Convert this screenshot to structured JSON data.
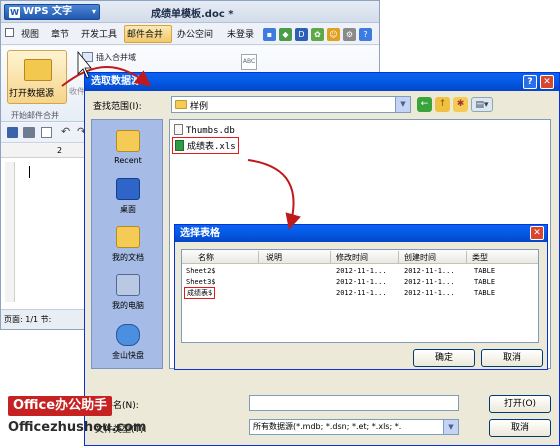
{
  "wps": {
    "app_button": "WPS 文字",
    "doc_title": "成绩单模板.doc *",
    "menu": [
      "视图",
      "章节",
      "开发工具",
      "邮件合并",
      "办公空间",
      "未登录"
    ],
    "ribbon": {
      "open_datasource": "打开数据源",
      "collect": "收件",
      "insert_merge_field": "插入合并域",
      "group_label": "开始邮件合并"
    },
    "ruler_mark": "2",
    "status_bar": "页面: 1/1   节:"
  },
  "dialog_select_source": {
    "title": "选取数据源",
    "lookin_label": "查找范围(I):",
    "lookin_value": "样例",
    "places": [
      "Recent",
      "桌面",
      "我的文档",
      "我的电脑",
      "金山快盘"
    ],
    "files": [
      "Thumbs.db",
      "成绩表.xls"
    ],
    "filename_label": "文件名(N):",
    "filename_value": "",
    "filetype_label": "文件类型(T):",
    "filetype_value": "所有数据源(*.mdb; *.dsn; *.et; *.xls; *.",
    "open_button": "打开(O)",
    "cancel_button": "取消"
  },
  "dialog_select_table": {
    "title": "选择表格",
    "columns": [
      "名称",
      "说明",
      "修改时间",
      "创建时间",
      "类型"
    ],
    "rows": [
      {
        "name": "Sheet2$",
        "desc": "",
        "modified": "2012-11-1...",
        "created": "2012-11-1...",
        "type": "TABLE"
      },
      {
        "name": "Sheet3$",
        "desc": "",
        "modified": "2012-11-1...",
        "created": "2012-11-1...",
        "type": "TABLE"
      },
      {
        "name": "成绩表$",
        "desc": "",
        "modified": "2012-11-1...",
        "created": "2012-11-1...",
        "type": "TABLE"
      }
    ],
    "ok_button": "确定",
    "cancel_button": "取消"
  },
  "watermark": {
    "badge": "Office办公助手",
    "url": "Officezhushou.com"
  },
  "colors": {
    "xp_title": "#0558e4",
    "highlight_red": "#e11a1a",
    "dialog_bg": "#ece9d8",
    "places_bar": "#a6bce6"
  }
}
